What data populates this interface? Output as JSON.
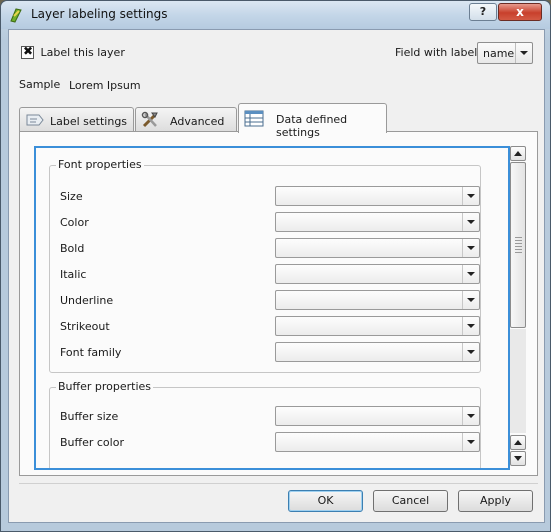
{
  "window": {
    "title": "Layer labeling settings",
    "help_label": "?",
    "close_label": "x"
  },
  "top": {
    "label_checkbox": {
      "label": "Label this layer",
      "checked": true
    },
    "field_label": "Field with labels",
    "field_value": "name",
    "sample_label": "Sample",
    "sample_value": "Lorem Ipsum"
  },
  "tabs": [
    {
      "label": "Label settings",
      "icon": "label-icon",
      "active": false
    },
    {
      "label": "Advanced",
      "icon": "tools-icon",
      "active": false
    },
    {
      "label": "Data defined settings",
      "icon": "table-icon",
      "active": true
    }
  ],
  "groups": {
    "font": {
      "title": "Font properties",
      "items": [
        "Size",
        "Color",
        "Bold",
        "Italic",
        "Underline",
        "Strikeout",
        "Font family"
      ]
    },
    "buffer": {
      "title": "Buffer properties",
      "items": [
        "Buffer size",
        "Buffer color"
      ]
    }
  },
  "buttons": {
    "ok": "OK",
    "cancel": "Cancel",
    "apply": "Apply"
  }
}
